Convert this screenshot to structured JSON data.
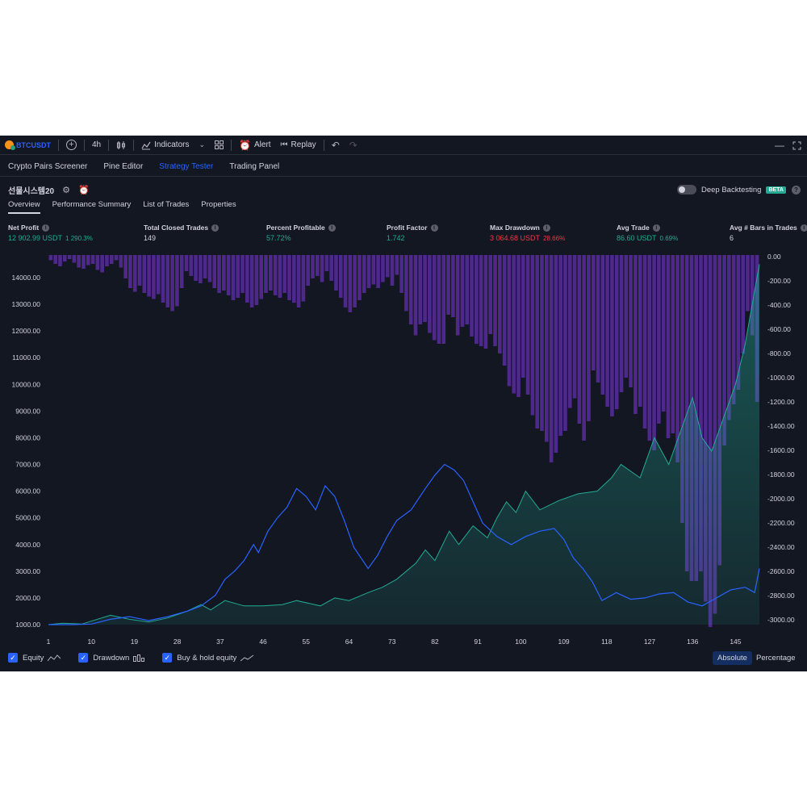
{
  "toolbar": {
    "symbol": "BTCUSDT",
    "interval": "4h",
    "indicators_label": "Indicators",
    "alert_label": "Alert",
    "replay_label": "Replay"
  },
  "panel_tabs": [
    {
      "label": "Crypto Pairs Screener"
    },
    {
      "label": "Pine Editor"
    },
    {
      "label": "Strategy Tester"
    },
    {
      "label": "Trading Panel"
    }
  ],
  "strategy": {
    "name": "선물시스템20",
    "deep_backtesting_label": "Deep Backtesting",
    "beta_badge": "BETA"
  },
  "sub_tabs": [
    {
      "label": "Overview"
    },
    {
      "label": "Performance Summary"
    },
    {
      "label": "List of Trades"
    },
    {
      "label": "Properties"
    }
  ],
  "metrics": [
    {
      "label": "Net Profit",
      "value": "12 902.99 USDT",
      "sub": "1 290.3%",
      "tone": "pos"
    },
    {
      "label": "Total Closed Trades",
      "value": "149",
      "sub": "",
      "tone": "wht"
    },
    {
      "label": "Percent Profitable",
      "value": "57.72%",
      "sub": "",
      "tone": "pos"
    },
    {
      "label": "Profit Factor",
      "value": "1.742",
      "sub": "",
      "tone": "pos"
    },
    {
      "label": "Max Drawdown",
      "value": "3 064.68 USDT",
      "sub": "28.66%",
      "tone": "neg"
    },
    {
      "label": "Avg Trade",
      "value": "86.60 USDT",
      "sub": "0.69%",
      "tone": "pos"
    },
    {
      "label": "Avg # Bars in Trades",
      "value": "6",
      "sub": "",
      "tone": "wht"
    }
  ],
  "legend": {
    "equity_label": "Equity",
    "drawdown_label": "Drawdown",
    "buyhold_label": "Buy & hold equity",
    "absolute_label": "Absolute",
    "percentage_label": "Percentage"
  },
  "colors": {
    "equity": "#22ab94",
    "buyhold": "#2962ff",
    "drawdown": "#5b2c9e",
    "background": "#131722"
  },
  "chart_data": {
    "type": "area",
    "x_ticks": [
      1,
      10,
      19,
      28,
      37,
      46,
      55,
      64,
      73,
      82,
      91,
      100,
      109,
      118,
      127,
      136,
      145
    ],
    "y_left_ticks": [
      "14000.00",
      "13000.00",
      "12000.00",
      "11000.00",
      "10000.00",
      "9000.00",
      "8000.00",
      "7000.00",
      "6000.00",
      "5000.00",
      "4000.00",
      "3000.00",
      "2000.00",
      "1000.00"
    ],
    "y_right_ticks": [
      "0.00",
      "-200.00",
      "-400.00",
      "-600.00",
      "-800.00",
      "-1000.00",
      "-1200.00",
      "-1400.00",
      "-1600.00",
      "-1800.00",
      "-2000.00",
      "-2200.00",
      "-2400.00",
      "-2600.00",
      "-2800.00",
      "-3000.00"
    ],
    "x_range": [
      1,
      150
    ],
    "y_left_range": [
      1000,
      14000
    ],
    "y_right_range": [
      0,
      -3000
    ],
    "series": [
      {
        "name": "Equity",
        "points": [
          [
            1,
            1000
          ],
          [
            4,
            1050
          ],
          [
            8,
            1020
          ],
          [
            14,
            1350
          ],
          [
            18,
            1200
          ],
          [
            22,
            1100
          ],
          [
            26,
            1250
          ],
          [
            30,
            1500
          ],
          [
            33,
            1750
          ],
          [
            35,
            1550
          ],
          [
            38,
            1900
          ],
          [
            42,
            1700
          ],
          [
            46,
            1700
          ],
          [
            50,
            1750
          ],
          [
            53,
            1900
          ],
          [
            58,
            1700
          ],
          [
            61,
            2000
          ],
          [
            64,
            1900
          ],
          [
            68,
            2200
          ],
          [
            71,
            2400
          ],
          [
            74,
            2700
          ],
          [
            78,
            3300
          ],
          [
            80,
            3800
          ],
          [
            82,
            3400
          ],
          [
            85,
            4500
          ],
          [
            87,
            4000
          ],
          [
            90,
            4700
          ],
          [
            93,
            4250
          ],
          [
            95,
            5000
          ],
          [
            97,
            5600
          ],
          [
            99,
            5200
          ],
          [
            101,
            6000
          ],
          [
            104,
            5300
          ],
          [
            108,
            5650
          ],
          [
            112,
            5900
          ],
          [
            116,
            6000
          ],
          [
            119,
            6500
          ],
          [
            121,
            7000
          ],
          [
            125,
            6500
          ],
          [
            128,
            8000
          ],
          [
            131,
            7000
          ],
          [
            134,
            8500
          ],
          [
            136,
            9500
          ],
          [
            138,
            8000
          ],
          [
            140,
            7500
          ],
          [
            143,
            9000
          ],
          [
            145,
            10000
          ],
          [
            147,
            11500
          ],
          [
            150,
            14500
          ]
        ]
      },
      {
        "name": "Buy & hold equity",
        "points": [
          [
            1,
            1000
          ],
          [
            6,
            1000
          ],
          [
            10,
            1020
          ],
          [
            14,
            1200
          ],
          [
            18,
            1300
          ],
          [
            22,
            1150
          ],
          [
            26,
            1300
          ],
          [
            30,
            1500
          ],
          [
            33,
            1700
          ],
          [
            36,
            2100
          ],
          [
            38,
            2700
          ],
          [
            40,
            3000
          ],
          [
            42,
            3400
          ],
          [
            44,
            4000
          ],
          [
            45,
            3700
          ],
          [
            47,
            4500
          ],
          [
            49,
            5000
          ],
          [
            51,
            5400
          ],
          [
            53,
            6100
          ],
          [
            55,
            5800
          ],
          [
            57,
            5300
          ],
          [
            59,
            6200
          ],
          [
            61,
            5800
          ],
          [
            63,
            4900
          ],
          [
            65,
            3900
          ],
          [
            68,
            3100
          ],
          [
            70,
            3600
          ],
          [
            72,
            4300
          ],
          [
            74,
            4900
          ],
          [
            77,
            5300
          ],
          [
            80,
            6100
          ],
          [
            82,
            6600
          ],
          [
            84,
            7000
          ],
          [
            86,
            6800
          ],
          [
            88,
            6400
          ],
          [
            90,
            5600
          ],
          [
            92,
            4800
          ],
          [
            95,
            4300
          ],
          [
            98,
            4000
          ],
          [
            101,
            4300
          ],
          [
            104,
            4500
          ],
          [
            107,
            4600
          ],
          [
            109,
            4200
          ],
          [
            111,
            3500
          ],
          [
            113,
            3100
          ],
          [
            115,
            2600
          ],
          [
            117,
            1900
          ],
          [
            120,
            2200
          ],
          [
            123,
            1950
          ],
          [
            126,
            2000
          ],
          [
            129,
            2150
          ],
          [
            132,
            2200
          ],
          [
            135,
            1850
          ],
          [
            138,
            1700
          ],
          [
            141,
            2000
          ],
          [
            144,
            2300
          ],
          [
            147,
            2400
          ],
          [
            149,
            2200
          ],
          [
            150,
            3100
          ]
        ]
      },
      {
        "name": "Drawdown",
        "values": [
          -30,
          -60,
          -80,
          -40,
          -20,
          -50,
          -90,
          -100,
          -70,
          -60,
          -110,
          -130,
          -80,
          -60,
          -30,
          -90,
          -180,
          -260,
          -290,
          -240,
          -300,
          -330,
          -350,
          -310,
          -380,
          -420,
          -450,
          -410,
          -260,
          -120,
          -160,
          -200,
          -220,
          -180,
          -210,
          -260,
          -300,
          -280,
          -320,
          -360,
          -340,
          -300,
          -380,
          -420,
          -400,
          -350,
          -300,
          -280,
          -320,
          -340,
          -300,
          -360,
          -380,
          -420,
          -370,
          -240,
          -180,
          -160,
          -210,
          -120,
          -200,
          -280,
          -340,
          -420,
          -460,
          -420,
          -360,
          -300,
          -260,
          -230,
          -260,
          -210,
          -170,
          -240,
          -150,
          -300,
          -450,
          -560,
          -650,
          -560,
          -540,
          -630,
          -690,
          -720,
          -720,
          -480,
          -500,
          -650,
          -580,
          -560,
          -660,
          -720,
          -740,
          -760,
          -640,
          -740,
          -800,
          -900,
          -1070,
          -1130,
          -1160,
          -1000,
          -1140,
          -1310,
          -1420,
          -1440,
          -1530,
          -1700,
          -1620,
          -1480,
          -1440,
          -1250,
          -1170,
          -1380,
          -1520,
          -1360,
          -940,
          -1040,
          -1140,
          -1240,
          -1320,
          -1260,
          -1120,
          -1000,
          -1080,
          -1300,
          -1240,
          -1420,
          -1520,
          -1600,
          -1380,
          -1280,
          -1500,
          -1460,
          -1700,
          -2200,
          -2600,
          -2680,
          -2680,
          -2600,
          -2850,
          -3060,
          -2950,
          -2550,
          -1560,
          -1350,
          -1220,
          -1100,
          -800,
          -450,
          -650,
          -1200
        ]
      }
    ],
    "legend_position": "bottom-left",
    "grid": false
  }
}
